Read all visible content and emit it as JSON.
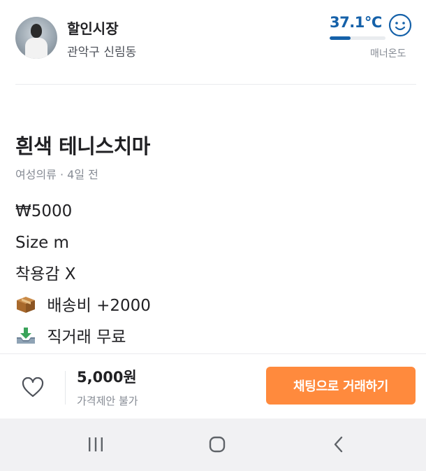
{
  "seller": {
    "name": "할인시장",
    "region": "관악구 신림동",
    "manner_temperature": "37.1°C",
    "manner_fraction": 0.37,
    "manner_label": "매너온도",
    "temp_color": "#1561a9"
  },
  "product": {
    "title": "흰색 테니스치마",
    "meta": "여성의류 · 4일 전",
    "description": [
      {
        "text": "₩5000"
      },
      {
        "text": "Size m"
      },
      {
        "text": "착용감 X"
      },
      {
        "icon": "package-icon",
        "text": "배송비 +2000"
      },
      {
        "icon": "inbox-tray-icon",
        "text": "직거래 무료"
      }
    ]
  },
  "bottom_bar": {
    "price": "5,000원",
    "price_note": "가격제안 불가",
    "chat_button": "채팅으로 거래하기",
    "accent_color": "#ff8a3d"
  },
  "navbar": {
    "buttons": [
      "recent-apps-icon",
      "home-icon",
      "back-icon"
    ]
  }
}
